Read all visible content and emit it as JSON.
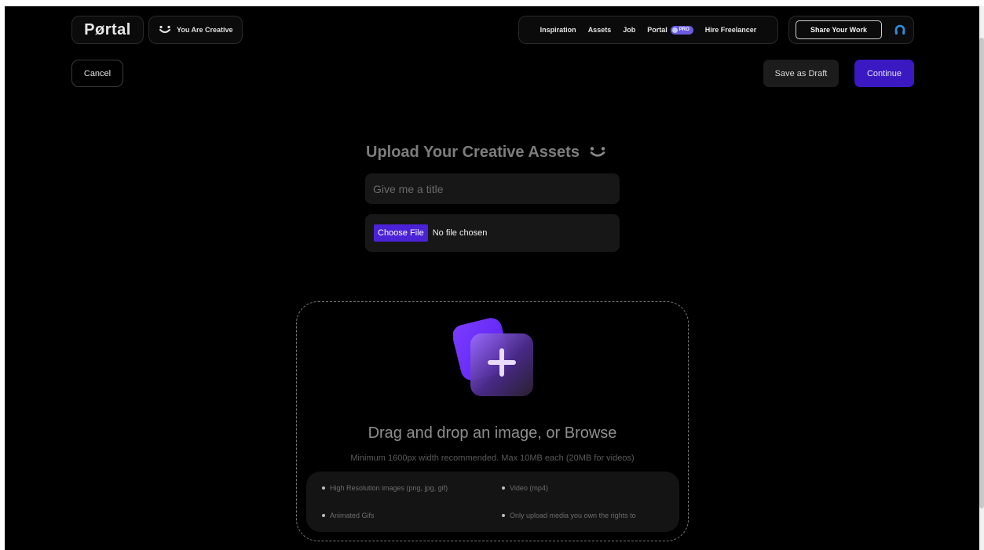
{
  "header": {
    "logo_text": "Pørtal",
    "tagline": "You Are Creative",
    "nav": [
      {
        "label": "Inspiration"
      },
      {
        "label": "Assets"
      },
      {
        "label": "Job"
      },
      {
        "label": "Portal",
        "badge": "PRO"
      },
      {
        "label": "Hire Freelancer"
      }
    ],
    "share_label": "Share Your Work",
    "avatar_icon": "headset-avatar-icon"
  },
  "actions": {
    "cancel_label": "Cancel",
    "draft_label": "Save as Draft",
    "continue_label": "Continue"
  },
  "form": {
    "heading": "Upload Your Creative Assets",
    "title_placeholder": "Give me a title",
    "choose_file_label": "Choose File",
    "file_status": "No file chosen"
  },
  "dropzone": {
    "title": "Drag and drop an image, or Browse",
    "subtitle": "Minimum 1600px width recommended. Max 10MB each (20MB for videos)",
    "requirements": [
      "High Resolution images (png, jpg, gif)",
      "Video (mp4)",
      "Animated Gifs",
      "Only upload media you own the rights to"
    ]
  },
  "colors": {
    "background": "#000000",
    "accent": "#3a18c2",
    "choose_button": "#4b22d6",
    "avatar": "#2f8fe0"
  }
}
